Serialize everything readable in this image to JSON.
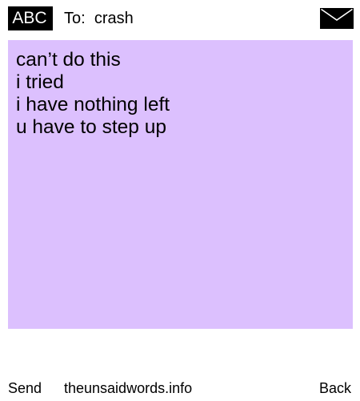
{
  "header": {
    "mode_label": "ABC",
    "recipient_prefix": "To:",
    "recipient_name": "crash",
    "envelope_icon": "envelope-icon"
  },
  "message": {
    "background_color": "#dcc0fe",
    "lines": [
      "can’t do this",
      "i tried",
      "i have nothing left",
      "u have to step up"
    ]
  },
  "footer": {
    "send_label": "Send",
    "site_text": "theunsaidwords.info",
    "back_label": "Back"
  }
}
